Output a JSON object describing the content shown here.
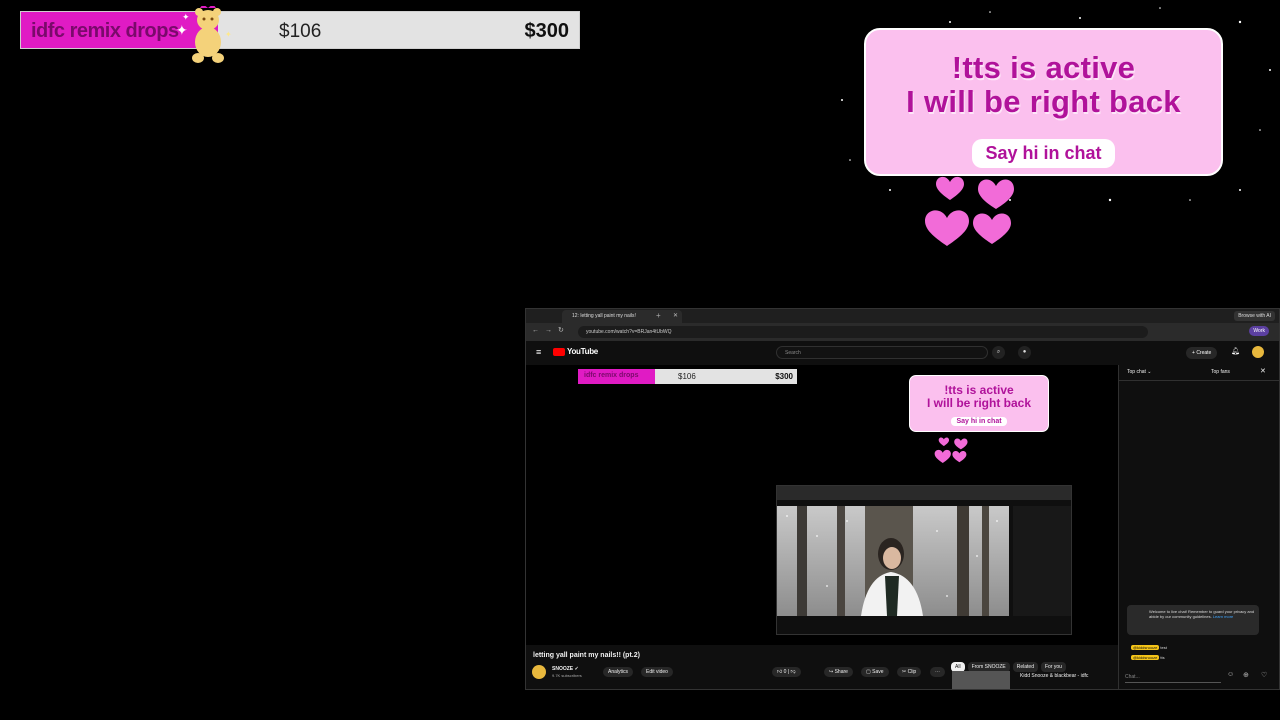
{
  "goal": {
    "label": "idfc remix drops",
    "current": "$106",
    "target": "$300",
    "progress": 0.353
  },
  "brb": {
    "line1": "!tts is active",
    "line2": "I will be right back",
    "cta": "Say hi in chat"
  },
  "browser": {
    "tab_title": "12: letting yall paint my nails!",
    "ai_button": "Browse with AI",
    "url": "youtube.com/watch?v=BRJan4tUbWQ",
    "work_badge": "Work"
  },
  "youtube": {
    "logo": "YouTube",
    "search_placeholder": "Search",
    "create_label": "Create",
    "video_title": "letting yall paint my nails!! (pt.2)",
    "channel": "SNOOZE",
    "subscribers": "9.7K subscribers",
    "buttons": {
      "analytics": "Analytics",
      "edit": "Edit video",
      "likes": "0",
      "share": "Share",
      "save": "Save",
      "clip": "Clip"
    },
    "chips": [
      "All",
      "From SNOOZE",
      "Related",
      "For you"
    ],
    "recommended": {
      "title": "Kidd Snooze & blackbear - idfc"
    }
  },
  "chat": {
    "mode": "Top chat",
    "fans": "Top fans",
    "welcome": "Welcome to live chat! Remember to guard your privacy and abide by our community guidelines.",
    "learn_more": "Learn more",
    "messages": [
      {
        "author": "@kiddsnooze",
        "text": "test"
      },
      {
        "author": "@kiddsnooze",
        "text": "tts"
      }
    ],
    "input_placeholder": "Chat..."
  },
  "colors": {
    "accent_pink": "#e01bc4",
    "card_pink": "#fbc0ee",
    "text_magenta": "#b0129a",
    "yt_red": "#ff0000"
  }
}
